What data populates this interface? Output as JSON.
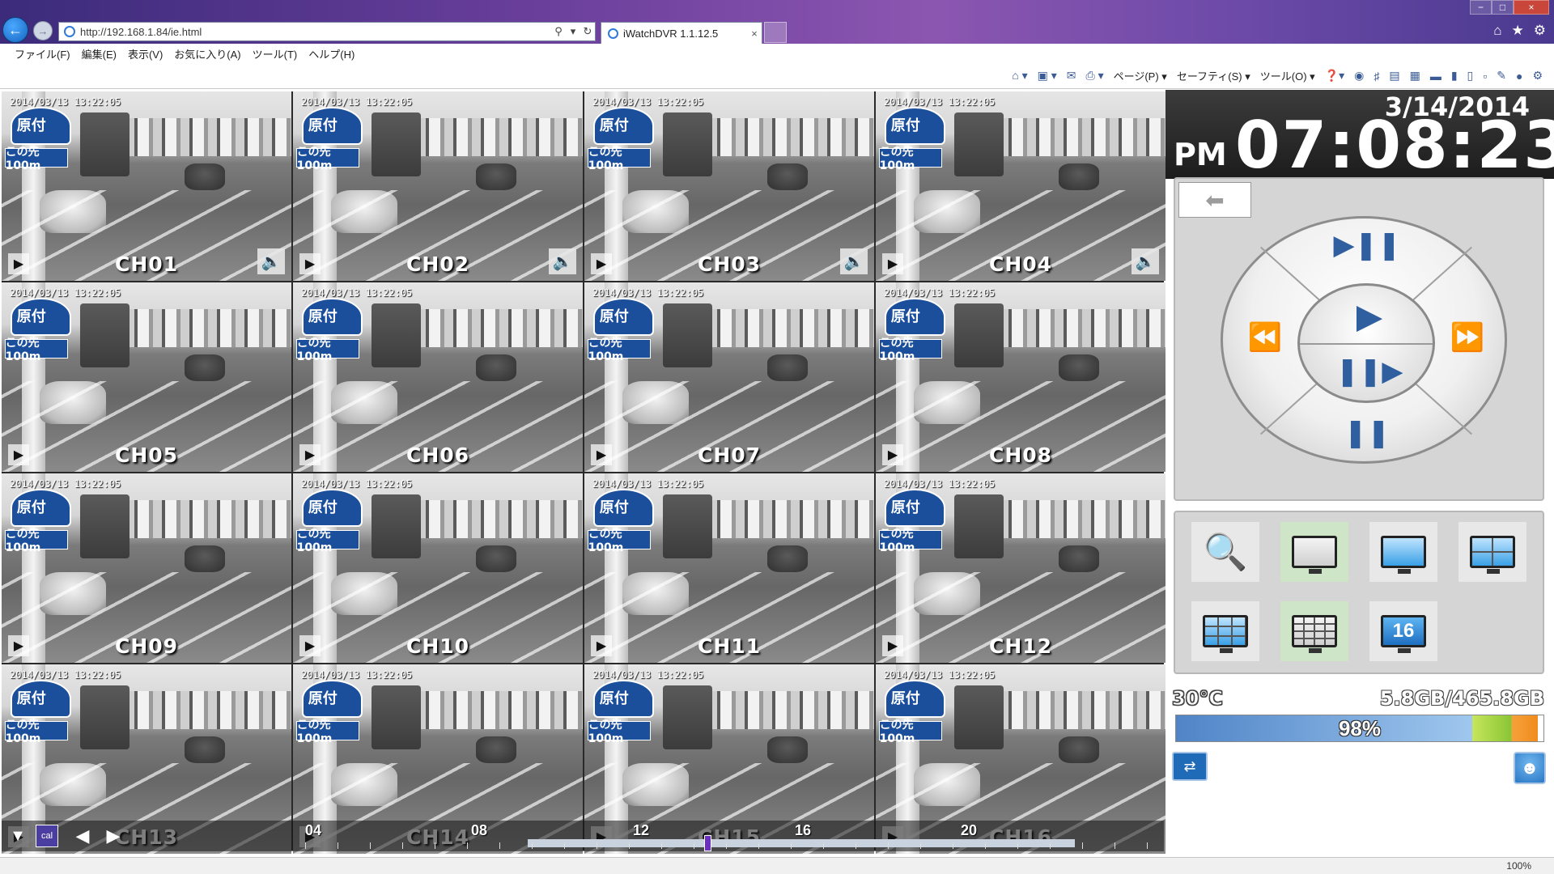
{
  "browser": {
    "address": "http://192.168.1.84/ie.html",
    "tab_title": "iWatchDVR 1.1.12.5",
    "tab_close": "×",
    "menu": [
      "ファイル(F)",
      "編集(E)",
      "表示(V)",
      "お気に入り(A)",
      "ツール(T)",
      "ヘルプ(H)"
    ],
    "command_bar": {
      "page": "ページ(P) ▾",
      "safety": "セーフティ(S) ▾",
      "tools": "ツール(O) ▾"
    },
    "icons": {
      "back": "back-arrow-icon",
      "forward": "forward-arrow-icon",
      "search": "search-icon",
      "refresh": "refresh-icon",
      "home": "home-icon",
      "favorites": "star-icon",
      "settings": "gear-icon"
    },
    "window": {
      "minimize": "−",
      "maximize": "□",
      "close": "×"
    },
    "zoom": "100%"
  },
  "cameras": {
    "timestamp": "2014/03/13 13:22:05",
    "sign_text": "原付",
    "sign_plate": "この先100m",
    "tiles": [
      {
        "label": "CH01",
        "audio": true
      },
      {
        "label": "CH02",
        "audio": true
      },
      {
        "label": "CH03",
        "audio": true
      },
      {
        "label": "CH04",
        "audio": true
      },
      {
        "label": "CH05",
        "audio": false
      },
      {
        "label": "CH06",
        "audio": false
      },
      {
        "label": "CH07",
        "audio": false
      },
      {
        "label": "CH08",
        "audio": false
      },
      {
        "label": "CH09",
        "audio": false
      },
      {
        "label": "CH10",
        "audio": false
      },
      {
        "label": "CH11",
        "audio": false
      },
      {
        "label": "CH12",
        "audio": false
      },
      {
        "label": "CH13",
        "audio": false
      },
      {
        "label": "CH14",
        "audio": false
      },
      {
        "label": "CH15",
        "audio": false
      },
      {
        "label": "CH16",
        "audio": false
      }
    ]
  },
  "timeline": {
    "hours": [
      "04",
      "08",
      "12",
      "16",
      "20"
    ],
    "cal_label": "cal",
    "prev": "◀",
    "next": "▶",
    "filter": "▼"
  },
  "clock": {
    "date": "3/14/2014",
    "ampm": "PM",
    "time": "07:08:23"
  },
  "status": {
    "temperature": "30°C",
    "storage": "5.8GB/465.8GB",
    "usage_percent": 98,
    "usage_label": "98%"
  },
  "tools": [
    {
      "name": "search-tool-button",
      "icon": "magnifier-icon"
    },
    {
      "name": "layout-1-button",
      "icon": "monitor-gray-icon",
      "active": true
    },
    {
      "name": "layout-full-button",
      "icon": "monitor-icon"
    },
    {
      "name": "layout-4-button",
      "icon": "monitor-grid4-icon"
    },
    {
      "name": "layout-9-button",
      "icon": "monitor-grid9-icon"
    },
    {
      "name": "layout-16-grid-button",
      "icon": "monitor-grid16-icon",
      "active": true
    },
    {
      "name": "layout-16-button",
      "icon": "monitor-16-icon",
      "label": "16"
    }
  ],
  "colors": {
    "storage_fill": "#4f84c7",
    "sign_blue": "#1b4f9b",
    "timeline_cursor": "#6a2fbf"
  }
}
